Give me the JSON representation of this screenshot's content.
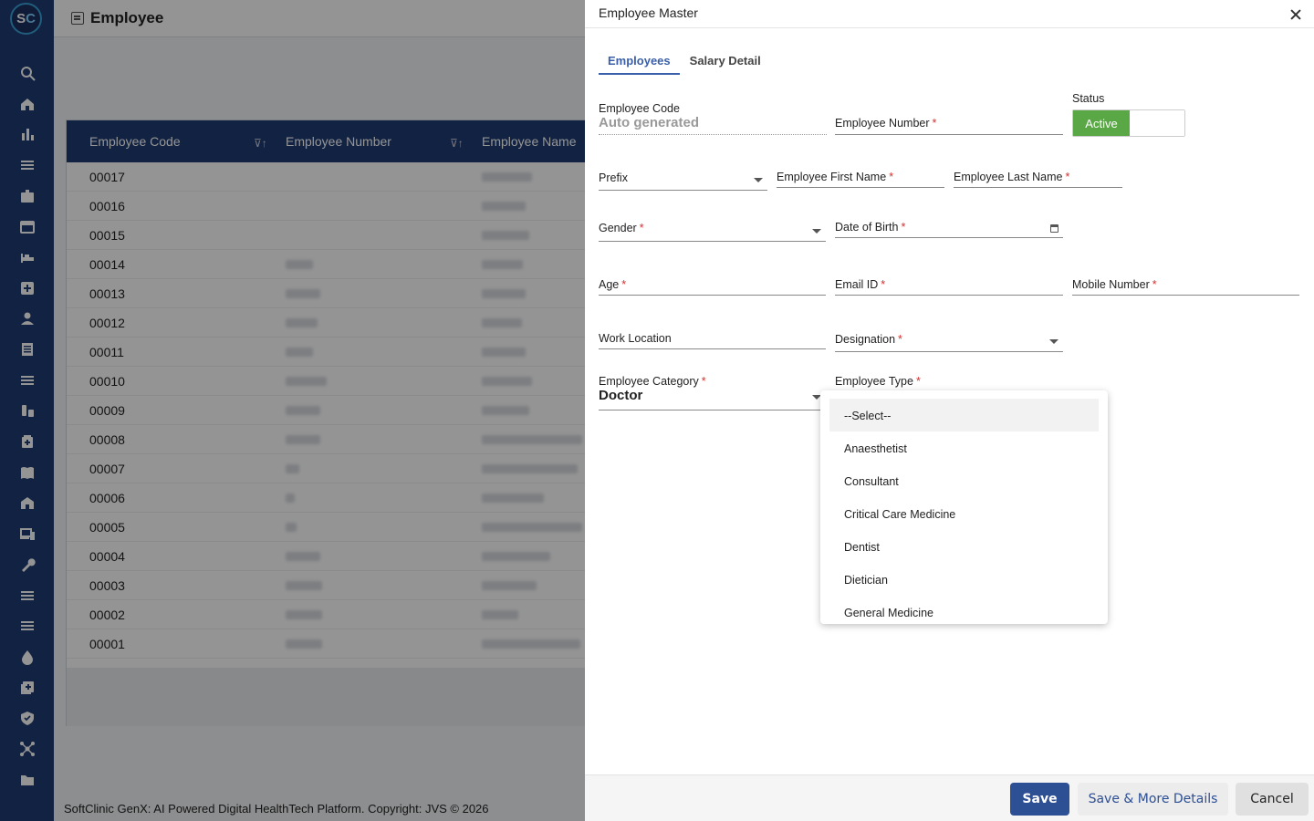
{
  "app": {
    "logo": {
      "s": "S",
      "c": "C"
    },
    "page_title": "Employee",
    "copyright": "SoftClinic GenX: AI Powered Digital HealthTech Platform. Copyright: JVS © 2026",
    "grid": {
      "columns": [
        "Employee Code",
        "Employee Number",
        "Employee Name"
      ],
      "rows": [
        "00017",
        "00016",
        "00015",
        "00014",
        "00013",
        "00012",
        "00011",
        "00010",
        "00009",
        "00008",
        "00007",
        "00006",
        "00005",
        "00004",
        "00003",
        "00002",
        "00001"
      ]
    },
    "sidebar_icons": [
      "search-icon",
      "home-icon",
      "chart-icon",
      "menu-icon",
      "id-badge-icon",
      "calendar-icon",
      "bed-icon",
      "medical-plus-icon",
      "person-icon",
      "document-icon",
      "menu-icon",
      "pharmacy-icon",
      "medicine-box-icon",
      "book-icon",
      "building-icon",
      "devices-icon",
      "wrench-icon",
      "menu-icon",
      "menu-icon",
      "blood-drop-icon",
      "add-box-icon",
      "shield-icon",
      "network-icon",
      "folder-icon"
    ]
  },
  "modal": {
    "title": "Employee Master",
    "tabs": [
      "Employees",
      "Salary Detail"
    ],
    "fields": {
      "employee_code": {
        "label": "Employee Code",
        "value": "Auto generated"
      },
      "employee_number": {
        "label": "Employee Number"
      },
      "status": {
        "label": "Status",
        "on_label": "Active"
      },
      "prefix": {
        "label": "Prefix"
      },
      "first_name": {
        "label": "Employee First Name"
      },
      "last_name": {
        "label": "Employee Last Name"
      },
      "gender": {
        "label": "Gender"
      },
      "dob": {
        "label": "Date of Birth"
      },
      "age": {
        "label": "Age"
      },
      "email": {
        "label": "Email ID"
      },
      "mobile": {
        "label": "Mobile Number"
      },
      "work_location": {
        "label": "Work Location"
      },
      "designation": {
        "label": "Designation"
      },
      "category": {
        "label": "Employee Category",
        "value": "Doctor"
      },
      "type": {
        "label": "Employee Type"
      }
    },
    "required_mark": "*",
    "type_options": [
      "--Select--",
      "Anaesthetist",
      "Consultant",
      "Critical Care Medicine",
      "Dentist",
      "Dietician",
      "General Medicine"
    ],
    "buttons": {
      "save": "Save",
      "save_more": "Save & More Details",
      "cancel": "Cancel"
    }
  },
  "colors": {
    "primary": "#1e3c72",
    "accent": "#2d4f94",
    "active": "#5aa845",
    "required": "#d32f2f"
  }
}
